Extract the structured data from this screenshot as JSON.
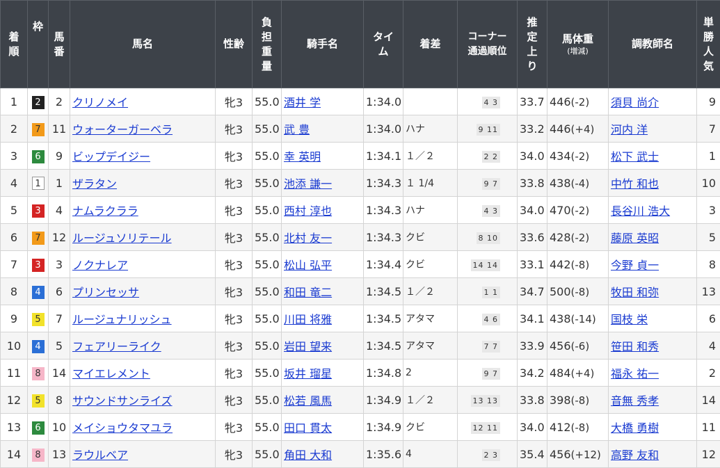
{
  "headers": {
    "rank": [
      "着",
      "順"
    ],
    "waku": "枠",
    "umaban": [
      "馬",
      "番"
    ],
    "horse": "馬名",
    "sexage": "性齢",
    "weight": [
      "負",
      "担",
      "重",
      "量"
    ],
    "jockey": "騎手名",
    "time": [
      "タイ",
      "ム"
    ],
    "margin": "着差",
    "corner": [
      "コーナー",
      "通過順位"
    ],
    "last3f": [
      "推",
      "定",
      "上",
      "り"
    ],
    "bodyweight": "馬体重",
    "bodyweight_sub": "(増減)",
    "trainer": "調教師名",
    "popularity": [
      "単",
      "勝",
      "人",
      "気"
    ]
  },
  "rows": [
    {
      "rank": "1",
      "waku": "2",
      "umaban": "2",
      "horse": "クリノメイ",
      "sexage": "牝3",
      "weight": "55.0",
      "jockey": "酒井 学",
      "time": "1:34.0",
      "margin": "",
      "corner": "4 3",
      "last3f": "33.7",
      "bw": "446",
      "diff": "(-2)",
      "trainer": "須貝 尚介",
      "pop": "9"
    },
    {
      "rank": "2",
      "waku": "7",
      "umaban": "11",
      "horse": "ウォーターガーベラ",
      "sexage": "牝3",
      "weight": "55.0",
      "jockey": "武 豊",
      "time": "1:34.0",
      "margin": "ハナ",
      "corner": "9 11",
      "last3f": "33.2",
      "bw": "446",
      "diff": "(+4)",
      "trainer": "河内 洋",
      "pop": "7"
    },
    {
      "rank": "3",
      "waku": "6",
      "umaban": "9",
      "horse": "ビップデイジー",
      "sexage": "牝3",
      "weight": "55.0",
      "jockey": "幸 英明",
      "time": "1:34.1",
      "margin": "１／２",
      "corner": "2 2",
      "last3f": "34.0",
      "bw": "434",
      "diff": "(-2)",
      "trainer": "松下 武士",
      "pop": "1"
    },
    {
      "rank": "4",
      "waku": "1",
      "umaban": "1",
      "horse": "ザラタン",
      "sexage": "牝3",
      "weight": "55.0",
      "jockey": "池添 謙一",
      "time": "1:34.3",
      "margin": "１ 1/4",
      "corner": "9 7",
      "last3f": "33.8",
      "bw": "438",
      "diff": "(-4)",
      "trainer": "中竹 和也",
      "pop": "10"
    },
    {
      "rank": "5",
      "waku": "3",
      "umaban": "4",
      "horse": "ナムラクララ",
      "sexage": "牝3",
      "weight": "55.0",
      "jockey": "西村 淳也",
      "time": "1:34.3",
      "margin": "ハナ",
      "corner": "4 3",
      "last3f": "34.0",
      "bw": "470",
      "diff": "(-2)",
      "trainer": "長谷川 浩大",
      "pop": "3"
    },
    {
      "rank": "6",
      "waku": "7",
      "umaban": "12",
      "horse": "ルージュソリテール",
      "sexage": "牝3",
      "weight": "55.0",
      "jockey": "北村 友一",
      "time": "1:34.3",
      "margin": "クビ",
      "corner": "8 10",
      "last3f": "33.6",
      "bw": "428",
      "diff": "(-2)",
      "trainer": "藤原 英昭",
      "pop": "5"
    },
    {
      "rank": "7",
      "waku": "3",
      "umaban": "3",
      "horse": "ノクナレア",
      "sexage": "牝3",
      "weight": "55.0",
      "jockey": "松山 弘平",
      "time": "1:34.4",
      "margin": "クビ",
      "corner": "14 14",
      "last3f": "33.1",
      "bw": "442",
      "diff": "(-8)",
      "trainer": "今野 貞一",
      "pop": "8"
    },
    {
      "rank": "8",
      "waku": "4",
      "umaban": "6",
      "horse": "プリンセッサ",
      "sexage": "牝3",
      "weight": "55.0",
      "jockey": "和田 竜二",
      "time": "1:34.5",
      "margin": "１／２",
      "corner": "1 1",
      "last3f": "34.7",
      "bw": "500",
      "diff": "(-8)",
      "trainer": "牧田 和弥",
      "pop": "13"
    },
    {
      "rank": "9",
      "waku": "5",
      "umaban": "7",
      "horse": "ルージュナリッシュ",
      "sexage": "牝3",
      "weight": "55.0",
      "jockey": "川田 将雅",
      "time": "1:34.5",
      "margin": "アタマ",
      "corner": "4 6",
      "last3f": "34.1",
      "bw": "438",
      "diff": "(-14)",
      "trainer": "国枝 栄",
      "pop": "6"
    },
    {
      "rank": "10",
      "waku": "4",
      "umaban": "5",
      "horse": "フェアリーライク",
      "sexage": "牝3",
      "weight": "55.0",
      "jockey": "岩田 望来",
      "time": "1:34.5",
      "margin": "アタマ",
      "corner": "7 7",
      "last3f": "33.9",
      "bw": "456",
      "diff": "(-6)",
      "trainer": "笹田 和秀",
      "pop": "4"
    },
    {
      "rank": "11",
      "waku": "8",
      "umaban": "14",
      "horse": "マイエレメント",
      "sexage": "牝3",
      "weight": "55.0",
      "jockey": "坂井 瑠星",
      "time": "1:34.8",
      "margin": "2",
      "corner": "9 7",
      "last3f": "34.2",
      "bw": "484",
      "diff": "(+4)",
      "trainer": "福永 祐一",
      "pop": "2"
    },
    {
      "rank": "12",
      "waku": "5",
      "umaban": "8",
      "horse": "サウンドサンライズ",
      "sexage": "牝3",
      "weight": "55.0",
      "jockey": "松若 風馬",
      "time": "1:34.9",
      "margin": "１／２",
      "corner": "13 13",
      "last3f": "33.8",
      "bw": "398",
      "diff": "(-8)",
      "trainer": "音無 秀孝",
      "pop": "14"
    },
    {
      "rank": "13",
      "waku": "6",
      "umaban": "10",
      "horse": "メイショウタマユラ",
      "sexage": "牝3",
      "weight": "55.0",
      "jockey": "田口 貫太",
      "time": "1:34.9",
      "margin": "クビ",
      "corner": "12 11",
      "last3f": "34.0",
      "bw": "412",
      "diff": "(-8)",
      "trainer": "大橋 勇樹",
      "pop": "11"
    },
    {
      "rank": "14",
      "waku": "8",
      "umaban": "13",
      "horse": "ラウルベア",
      "sexage": "牝3",
      "weight": "55.0",
      "jockey": "角田 大和",
      "time": "1:35.6",
      "margin": "4",
      "corner": "2 3",
      "last3f": "35.4",
      "bw": "456",
      "diff": "(+12)",
      "trainer": "高野 友和",
      "pop": "12"
    }
  ],
  "colors": {
    "header_bg": "#3d4249",
    "link": "#1a3bd1",
    "waku_1": "#ffffff",
    "waku_2": "#222222",
    "waku_3": "#d42424",
    "waku_4": "#2b6fd6",
    "waku_5": "#f2e22a",
    "waku_6": "#2d8a3e",
    "waku_7": "#f29a1a",
    "waku_8": "#f6b6c8"
  }
}
